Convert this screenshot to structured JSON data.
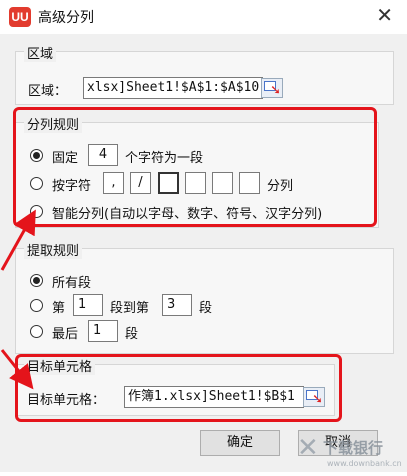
{
  "dialog": {
    "logo": "UU",
    "title": "高级分列",
    "close": "✕"
  },
  "region": {
    "legend": "区域",
    "label": "区域：",
    "value": "xlsx]Sheet1!$A$1:$A$10"
  },
  "split_rules": {
    "legend": "分列规则",
    "fixed": {
      "label": "固定",
      "count": "4",
      "suffix": "个字符为一段",
      "selected": true
    },
    "by_char": {
      "label": "按字符",
      "chars": [
        ",",
        "/",
        "",
        "",
        "",
        ""
      ],
      "suffix": "分列",
      "selected": false
    },
    "smart": {
      "label": "智能分列(自动以字母、数字、符号、汉字分列)",
      "selected": false
    }
  },
  "extract_rules": {
    "legend": "提取规则",
    "all": {
      "label": "所有段",
      "selected": true
    },
    "range": {
      "from_label": "第",
      "from": "1",
      "to_label": "段到第",
      "to": "3",
      "end_label": "段",
      "selected": false
    },
    "last": {
      "label": "最后",
      "count": "1",
      "end_label": "段",
      "selected": false
    }
  },
  "target": {
    "legend": "目标单元格",
    "label": "目标单元格：",
    "value": "作簿1.xlsx]Sheet1!$B$1"
  },
  "buttons": {
    "ok": "确定",
    "cancel": "取消"
  },
  "watermark": {
    "name": "下载银行",
    "url": "www.downbank.cn"
  },
  "colors": {
    "highlight": "#e4141b",
    "logo": "#e23b2e"
  }
}
